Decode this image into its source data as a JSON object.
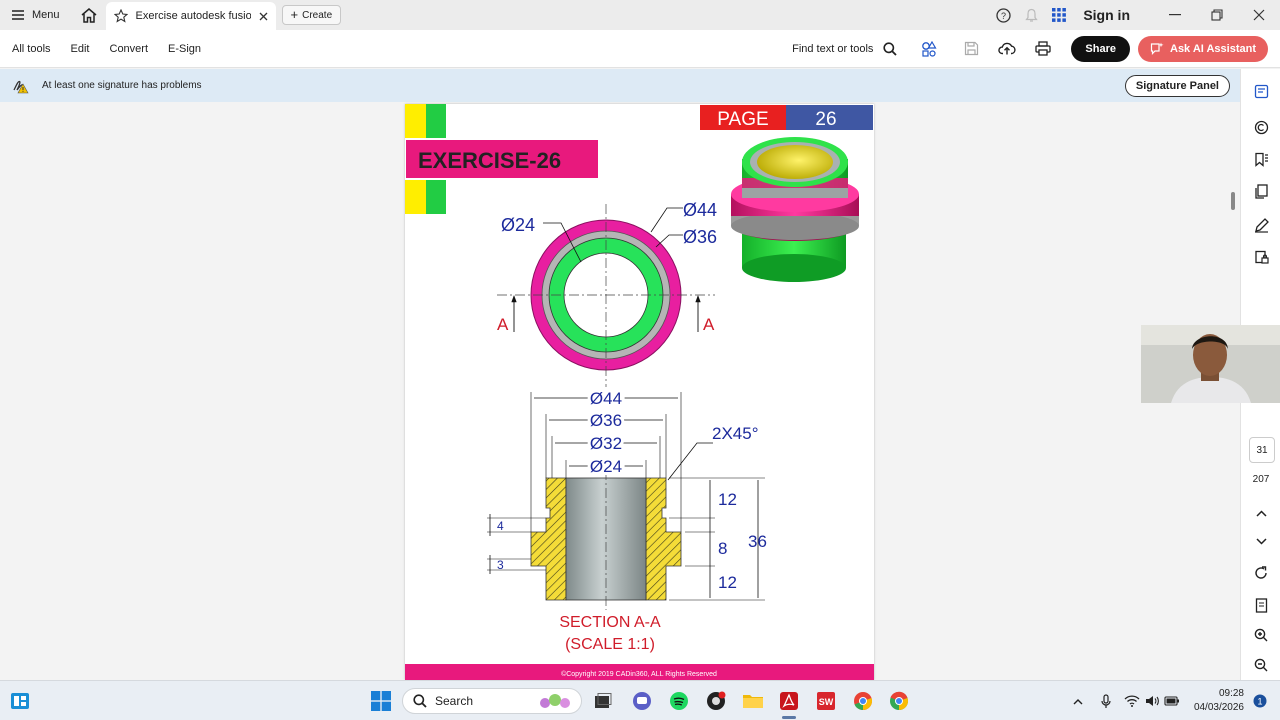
{
  "titlebar": {
    "menu_label": "Menu",
    "tab_title": "Exercise autodesk fusion...",
    "create_label": "Create",
    "signin_label": "Sign in"
  },
  "toolbar": {
    "menu": [
      "All tools",
      "Edit",
      "Convert",
      "E-Sign"
    ],
    "find_label": "Find text or tools",
    "share_label": "Share",
    "ai_label": "Ask AI Assistant"
  },
  "banner": {
    "message": "At least one signature has problems",
    "signature_panel_label": "Signature Panel"
  },
  "document": {
    "page_label": "PAGE",
    "page_number": "26",
    "exercise_label": "EXERCISE-26",
    "dims_top": {
      "d24": "Ø24",
      "d44": "Ø44",
      "d36": "Ø36"
    },
    "section_marker": "A",
    "dims_section": {
      "d44": "Ø44",
      "d36": "Ø36",
      "d32": "Ø32",
      "d24": "Ø24",
      "chamfer": "2X45°",
      "h12a": "12",
      "h8": "8",
      "h12b": "12",
      "h36": "36",
      "g4": "4",
      "g3": "3"
    },
    "section_title": "SECTION A-A",
    "section_scale": "(SCALE 1:1)",
    "copyright": "©Copyright 2019 CADin360, ALL Rights Reserved"
  },
  "navigation": {
    "current_page": "31",
    "total_pages": "207"
  },
  "taskbar": {
    "search_label": "Search",
    "time": "09:28",
    "date": "04/03/2026",
    "notification_count": "1"
  },
  "colors": {
    "magenta": "#e8197d",
    "green": "#22dd44",
    "yellow": "#ffee00",
    "dim_blue": "#1c2a9c",
    "red": "#e02020",
    "page_blue": "#3f57a3"
  }
}
